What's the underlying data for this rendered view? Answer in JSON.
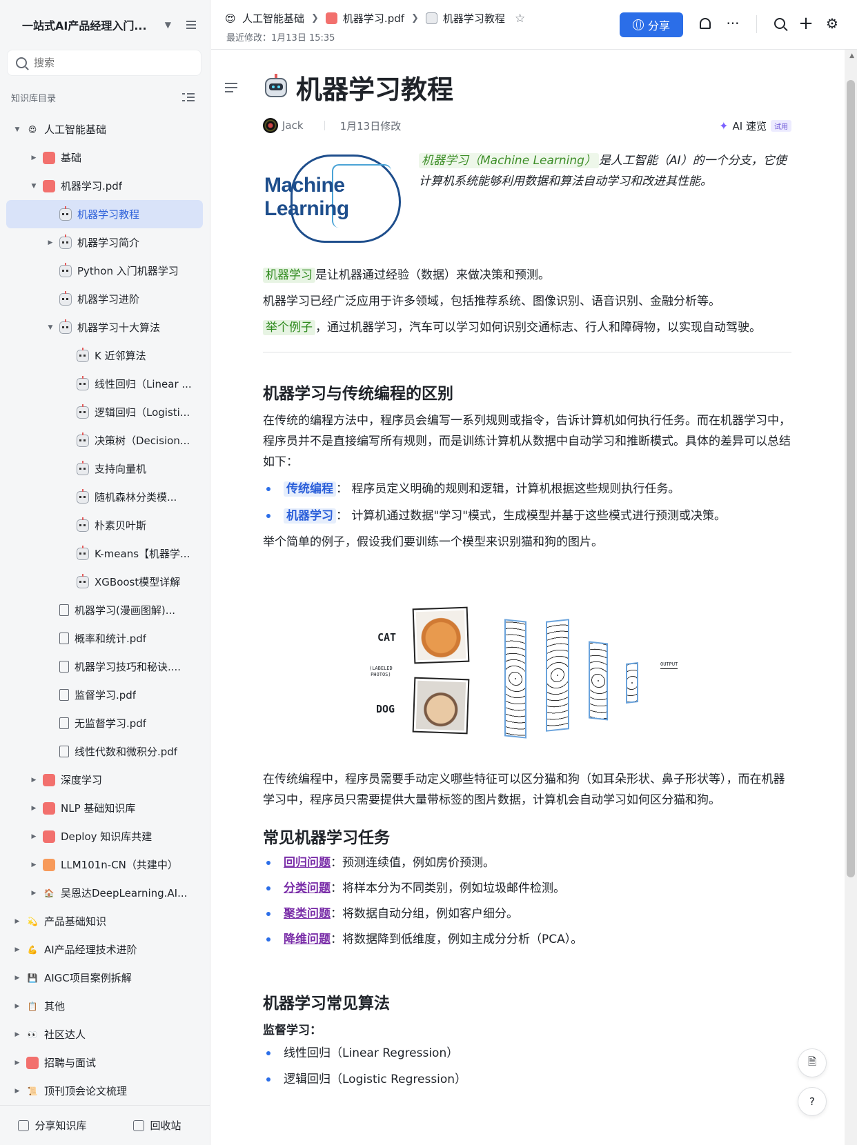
{
  "sidebar": {
    "title": "一站式AI产品经理入门...",
    "search_placeholder": "搜索",
    "directory_label": "知识库目录",
    "items": [
      {
        "label": "人工智能基础",
        "icon": "smiling-face-emoji",
        "arrow": "▼"
      },
      {
        "label": "基础",
        "icon": "grid-icon",
        "arrow": "▶"
      },
      {
        "label": "机器学习.pdf",
        "icon": "book-icon",
        "arrow": "▼"
      },
      {
        "label": "机器学习教程",
        "icon": "robot-icon",
        "arrow": ""
      },
      {
        "label": "机器学习简介",
        "icon": "robot-icon",
        "arrow": "▶"
      },
      {
        "label": "Python 入门机器学习",
        "icon": "robot-icon",
        "arrow": ""
      },
      {
        "label": "机器学习进阶",
        "icon": "robot-icon",
        "arrow": ""
      },
      {
        "label": "机器学习十大算法",
        "icon": "robot-icon",
        "arrow": "▼"
      },
      {
        "label": "K 近邻算法",
        "icon": "robot-icon",
        "arrow": ""
      },
      {
        "label": "线性回归（Linear ...",
        "icon": "robot-icon",
        "arrow": ""
      },
      {
        "label": "逻辑回归（Logisti...",
        "icon": "robot-icon",
        "arrow": ""
      },
      {
        "label": "决策树（Decision...",
        "icon": "robot-icon",
        "arrow": ""
      },
      {
        "label": "支持向量机",
        "icon": "robot-icon",
        "arrow": ""
      },
      {
        "label": "随机森林分类模...",
        "icon": "robot-icon",
        "arrow": ""
      },
      {
        "label": "朴素贝叶斯",
        "icon": "robot-icon",
        "arrow": ""
      },
      {
        "label": "K-means【机器学...",
        "icon": "robot-icon",
        "arrow": ""
      },
      {
        "label": "XGBoost模型详解",
        "icon": "robot-icon",
        "arrow": ""
      },
      {
        "label": "机器学习(漫画图解)...",
        "icon": "pdf-file-icon",
        "arrow": ""
      },
      {
        "label": "概率和统计.pdf",
        "icon": "pdf-file-icon",
        "arrow": ""
      },
      {
        "label": "机器学习技巧和秘诀....",
        "icon": "pdf-file-icon",
        "arrow": ""
      },
      {
        "label": "监督学习.pdf",
        "icon": "pdf-file-icon",
        "arrow": ""
      },
      {
        "label": "无监督学习.pdf",
        "icon": "pdf-file-icon",
        "arrow": ""
      },
      {
        "label": "线性代数和微积分.pdf",
        "icon": "pdf-file-icon",
        "arrow": ""
      },
      {
        "label": "深度学习",
        "icon": "book-icon",
        "arrow": "▶"
      },
      {
        "label": "NLP 基础知识库",
        "icon": "book-icon",
        "arrow": "▶"
      },
      {
        "label": "Deploy 知识库共建",
        "icon": "chart-icon",
        "arrow": "▶"
      },
      {
        "label": "LLM101n-CN（共建中）",
        "icon": "monitor-icon",
        "arrow": "▶"
      },
      {
        "label": "吴恩达DeepLearning.AI...",
        "icon": "house-icon",
        "arrow": "▶"
      },
      {
        "label": "产品基础知识",
        "icon": "dizzy-emoji",
        "arrow": "▶"
      },
      {
        "label": "AI产品经理技术进阶",
        "icon": "flexed-biceps-emoji",
        "arrow": "▶"
      },
      {
        "label": "AIGC项目案例拆解",
        "icon": "floppy-disk-emoji",
        "arrow": "▶"
      },
      {
        "label": "其他",
        "icon": "clipboard-emoji",
        "arrow": "▶"
      },
      {
        "label": "社区达人",
        "icon": "eyes-emoji",
        "arrow": "▶"
      },
      {
        "label": "招聘与面试",
        "icon": "envelope-emoji",
        "arrow": "▶"
      },
      {
        "label": "顶刊顶会论文梳理",
        "icon": "scroll-emoji",
        "arrow": "▶"
      }
    ],
    "footer": {
      "share_label": "分享知识库",
      "trash_label": "回收站"
    }
  },
  "topbar": {
    "breadcrumbs": [
      "人工智能基础",
      "机器学习.pdf",
      "机器学习教程"
    ],
    "last_modified": "最近修改：1月13日 15:35",
    "share_label": "分享",
    "more_label": "···"
  },
  "doc": {
    "title": "机器学习教程",
    "author": "Jack",
    "modified": "1月13日修改",
    "ai_read": "AI 速览",
    "trial": "试用",
    "logo_text_1": "Machine",
    "logo_text_2": "Learning",
    "intro_highlight": "机器学习（Machine Learning）",
    "intro_rest": "是人工智能（AI）的一个分支，它使计算机系统能够利用数据和算法自动学习和改进其性能。",
    "p1_tag": "机器学习",
    "p1_rest": "是让机器通过经验（数据）来做决策和预测。",
    "p2": "机器学习已经广泛应用于许多领域，包括推荐系统、图像识别、语音识别、金融分析等。",
    "p3_tag": "举个例子",
    "p3_rest": "，通过机器学习，汽车可以学习如何识别交通标志、行人和障碍物，以实现自动驾驶。",
    "h_diff": "机器学习与传统编程的区别",
    "p_diff": "在传统的编程方法中，程序员会编写一系列规则或指令，告诉计算机如何执行任务。而在机器学习中，程序员并不是直接编写所有规则，而是训练计算机从数据中自动学习和推断模式。具体的差异可以总结如下：",
    "diff_items": [
      {
        "kw": "传统编程",
        "text": "： 程序员定义明确的规则和逻辑，计算机根据这些规则执行任务。"
      },
      {
        "kw": "机器学习",
        "text": "： 计算机通过数据\"学习\"模式，生成模型并基于这些模式进行预测或决策。"
      }
    ],
    "p_example": "举个简单的例子，假设我们要训练一个模型来识别猫和狗的图片。",
    "figure": {
      "cat": "CAT",
      "dog": "DOG",
      "labeled_1": "(LABELED",
      "labeled_2": "PHOTOS)",
      "output": "OUTPUT"
    },
    "p_after_fig": "在传统编程中，程序员需要手动定义哪些特征可以区分猫和狗（如耳朵形状、鼻子形状等），而在机器学习中，程序员只需要提供大量带标签的图片数据，计算机会自动学习如何区分猫和狗。",
    "h_tasks": "常见机器学习任务",
    "tasks": [
      {
        "kw": "回归问题",
        "text": "：预测连续值，例如房价预测。"
      },
      {
        "kw": "分类问题",
        "text": "：将样本分为不同类别，例如垃圾邮件检测。"
      },
      {
        "kw": "聚类问题",
        "text": "：将数据自动分组，例如客户细分。"
      },
      {
        "kw": "降维问题",
        "text": "：将数据降到低维度，例如主成分分析（PCA）。"
      }
    ],
    "h_algos": "机器学习常见算法",
    "supervised": "监督学习：",
    "algos": [
      "线性回归（Linear Regression）",
      "逻辑回归（Logistic Regression）"
    ]
  }
}
